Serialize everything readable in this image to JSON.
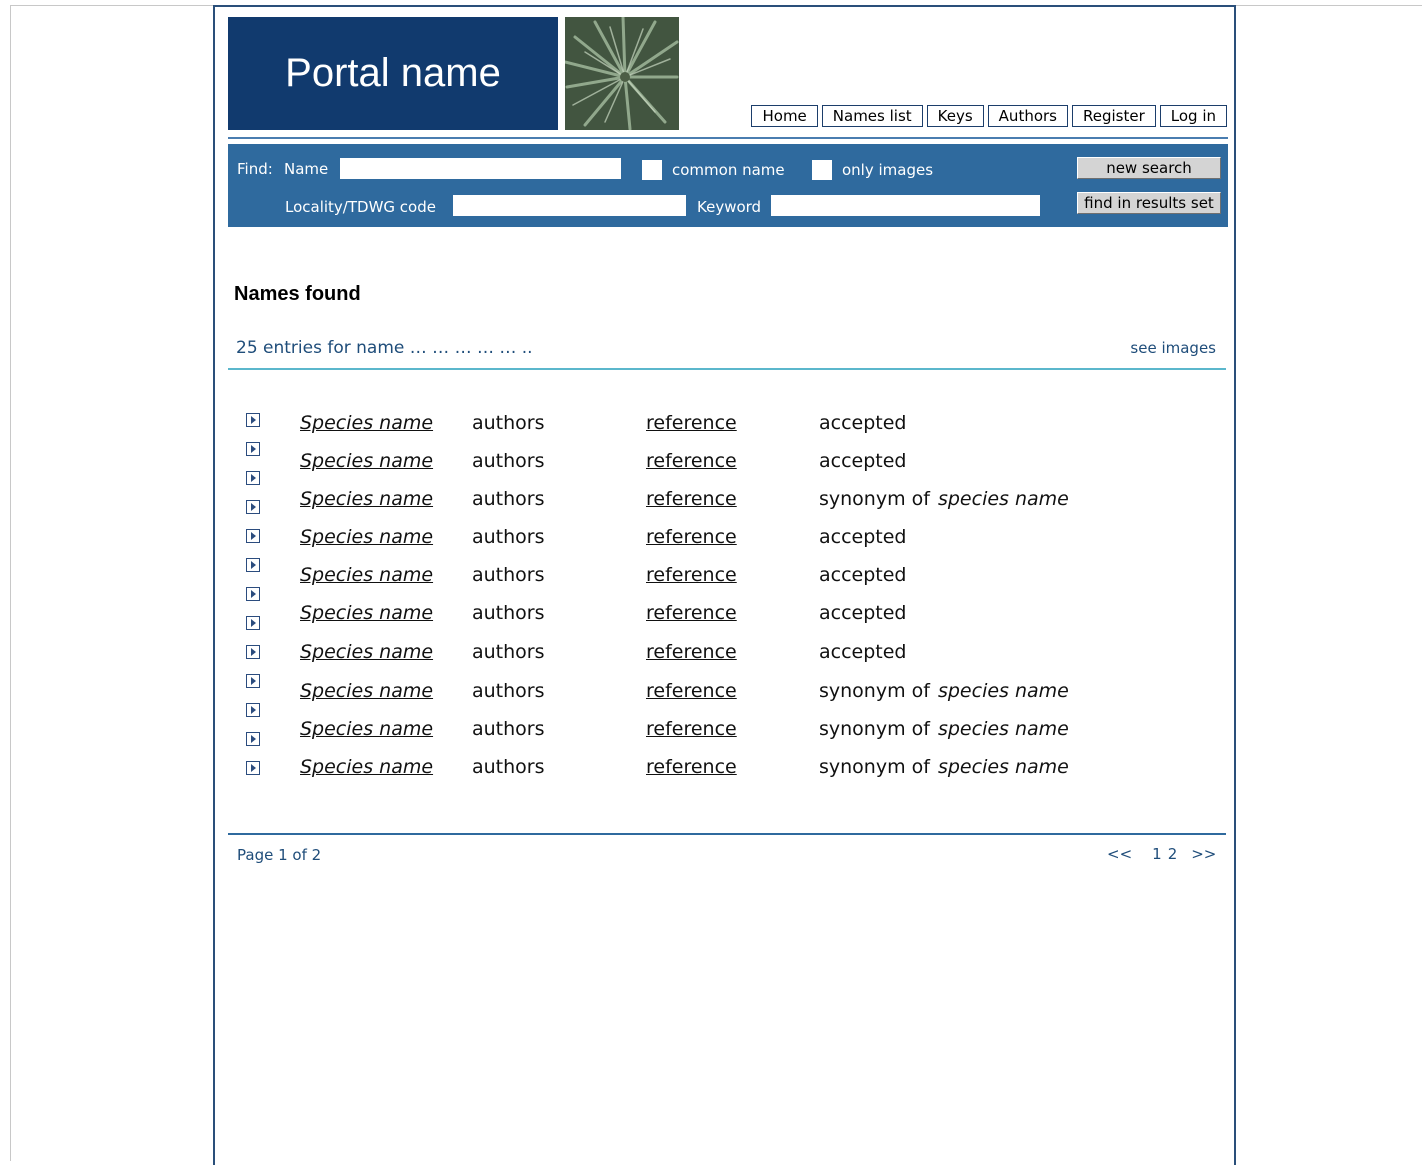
{
  "header": {
    "portal_name": "Portal name"
  },
  "nav": {
    "items": [
      "Home",
      "Names list",
      "Keys",
      "Authors",
      "Register",
      "Log in"
    ]
  },
  "search": {
    "find_label": "Find:",
    "name_label": "Name",
    "name_value": "",
    "common_name_label": "common name",
    "only_images_label": "only images",
    "locality_label": "Locality/TDWG code",
    "locality_value": "",
    "keyword_label": "Keyword",
    "keyword_value": "",
    "new_search_label": "new search",
    "find_in_results_label": "find in results set"
  },
  "results": {
    "heading": "Names found",
    "summary": "25 entries for name … … … … … ..",
    "see_images": "see images",
    "rows": [
      {
        "species": "Species name",
        "authors": "authors",
        "reference": "reference",
        "status": "accepted",
        "synonym_of": ""
      },
      {
        "species": "Species name",
        "authors": "authors",
        "reference": "reference",
        "status": "accepted",
        "synonym_of": ""
      },
      {
        "species": "Species name",
        "authors": "authors",
        "reference": "reference",
        "status": "synonym of",
        "synonym_of": "species name"
      },
      {
        "species": "Species name",
        "authors": "authors",
        "reference": "reference",
        "status": "accepted",
        "synonym_of": ""
      },
      {
        "species": "Species name",
        "authors": "authors",
        "reference": "reference",
        "status": "accepted",
        "synonym_of": ""
      },
      {
        "species": "Species name",
        "authors": "authors",
        "reference": "reference",
        "status": "accepted",
        "synonym_of": ""
      },
      {
        "species": "Species name",
        "authors": "authors",
        "reference": "reference",
        "status": "accepted",
        "synonym_of": ""
      },
      {
        "species": "Species name",
        "authors": "authors",
        "reference": "reference",
        "status": "synonym of",
        "synonym_of": "species name"
      },
      {
        "species": "Species name",
        "authors": "authors",
        "reference": "reference",
        "status": "synonym of",
        "synonym_of": "species name"
      },
      {
        "species": "Species name",
        "authors": "authors",
        "reference": "reference",
        "status": "synonym of",
        "synonym_of": "species name"
      }
    ],
    "expand_icon_count": 13
  },
  "pagination": {
    "page_info": "Page 1 of 2",
    "first": "<<",
    "page1": "1",
    "page2": "2",
    "last": ">>"
  },
  "colors": {
    "banner": "#113a6e",
    "searchbar": "#2f6a9e",
    "link_text": "#1f4d7a",
    "divider_teal": "#5bb7cc"
  },
  "icons": {
    "row_icon": "expand-arrow-icon"
  }
}
